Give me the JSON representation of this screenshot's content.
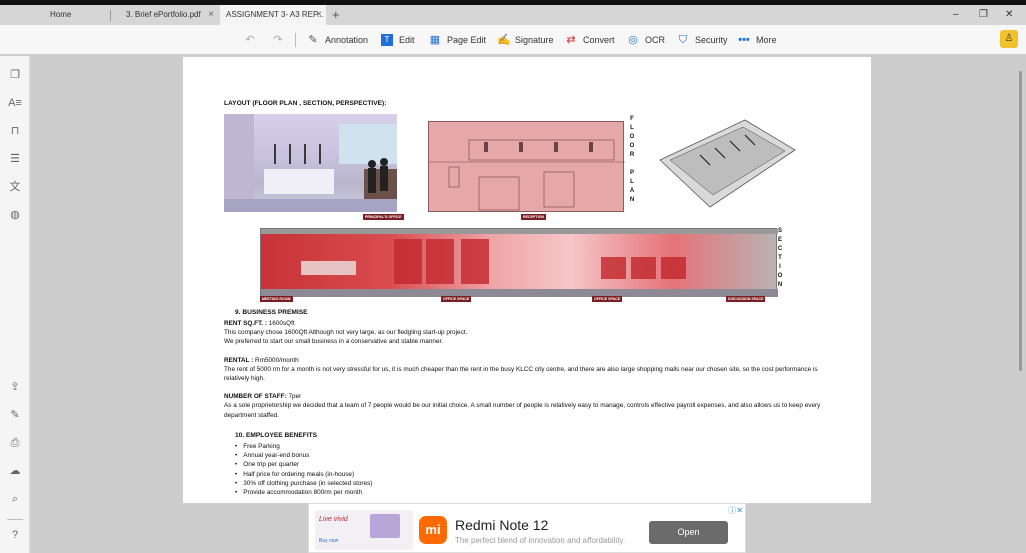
{
  "tabs": [
    {
      "label": "Home"
    },
    {
      "label": "3. Brief ePortfolio.pdf"
    },
    {
      "label": "ASSIGNMENT 3- A3 REP..."
    }
  ],
  "window": {
    "minimize": "–",
    "restore": "❐",
    "close": "✕"
  },
  "toolbar": {
    "undo": "↶",
    "redo": "↷",
    "annotation": "Annotation",
    "edit": "Edit",
    "page_edit": "Page Edit",
    "signature": "Signature",
    "convert": "Convert",
    "ocr": "OCR",
    "security": "Security",
    "more": "More"
  },
  "document": {
    "layout_heading": "LAYOUT (FLOOR PLAN , SECTION, PERSPECTIVE):",
    "floor_plan_letters": [
      "F",
      "L",
      "O",
      "O",
      "R",
      "",
      "P",
      "L",
      "A",
      "N"
    ],
    "section_letters": [
      "S",
      "E",
      "C",
      "T",
      "I",
      "O",
      "N"
    ],
    "labels": {
      "principal": "PRINCIPAL'S OFFICE",
      "reception": "RECEPTION",
      "meeting": "MEETING ROOM",
      "office1": "OFFICE SPACE",
      "office2": "OFFICE SPACE",
      "discussion": "DISCUSSION SPACE"
    },
    "s9": "9.   BUSINESS PREMISE",
    "rent_label": "RENT SQ.FT. :",
    "rent_value": " 1600sQft",
    "rent_p1": "This company chose 1600Qft Although not very large, as our fledgling start-up project.",
    "rent_p2": "We preferred to start our small business in a conservative and stable manner.",
    "rental_label": "RENTAL :",
    "rental_value": " Rm5000/month",
    "rental_p": "The rent of 5000 rm for a month  is not very stressful for us, it is much cheaper than the rent in the busy KLCC city centre, and there are also large shopping malls near our chosen site, so the cost performance is relatively high.",
    "staff_label": "NUMBER OF STAFF:",
    "staff_value": " 7per",
    "staff_p": "As a sole proprietorship we decided that a team of 7 people would be our initial choice. A small number of people is relatively easy to manage, controls effective payroll expenses, and also allows us to keep every department staffed.",
    "s10": "10.  EMPLOYEE BENEFITS",
    "benefits": [
      "Free Parking",
      "Annual year-end bonus",
      "One trip per quarter",
      "Half price for ordering meals (in-house)",
      "30% off clothing purchase (in selected stores)",
      "Provide accommodation 800rm per month"
    ]
  },
  "ad": {
    "title": "Redmi Note 12",
    "subtitle": "The perfect blend of innovation and affordability.",
    "button": "Open",
    "logo": "mi",
    "image_text": "Live vivid",
    "buy": "Buy now"
  }
}
